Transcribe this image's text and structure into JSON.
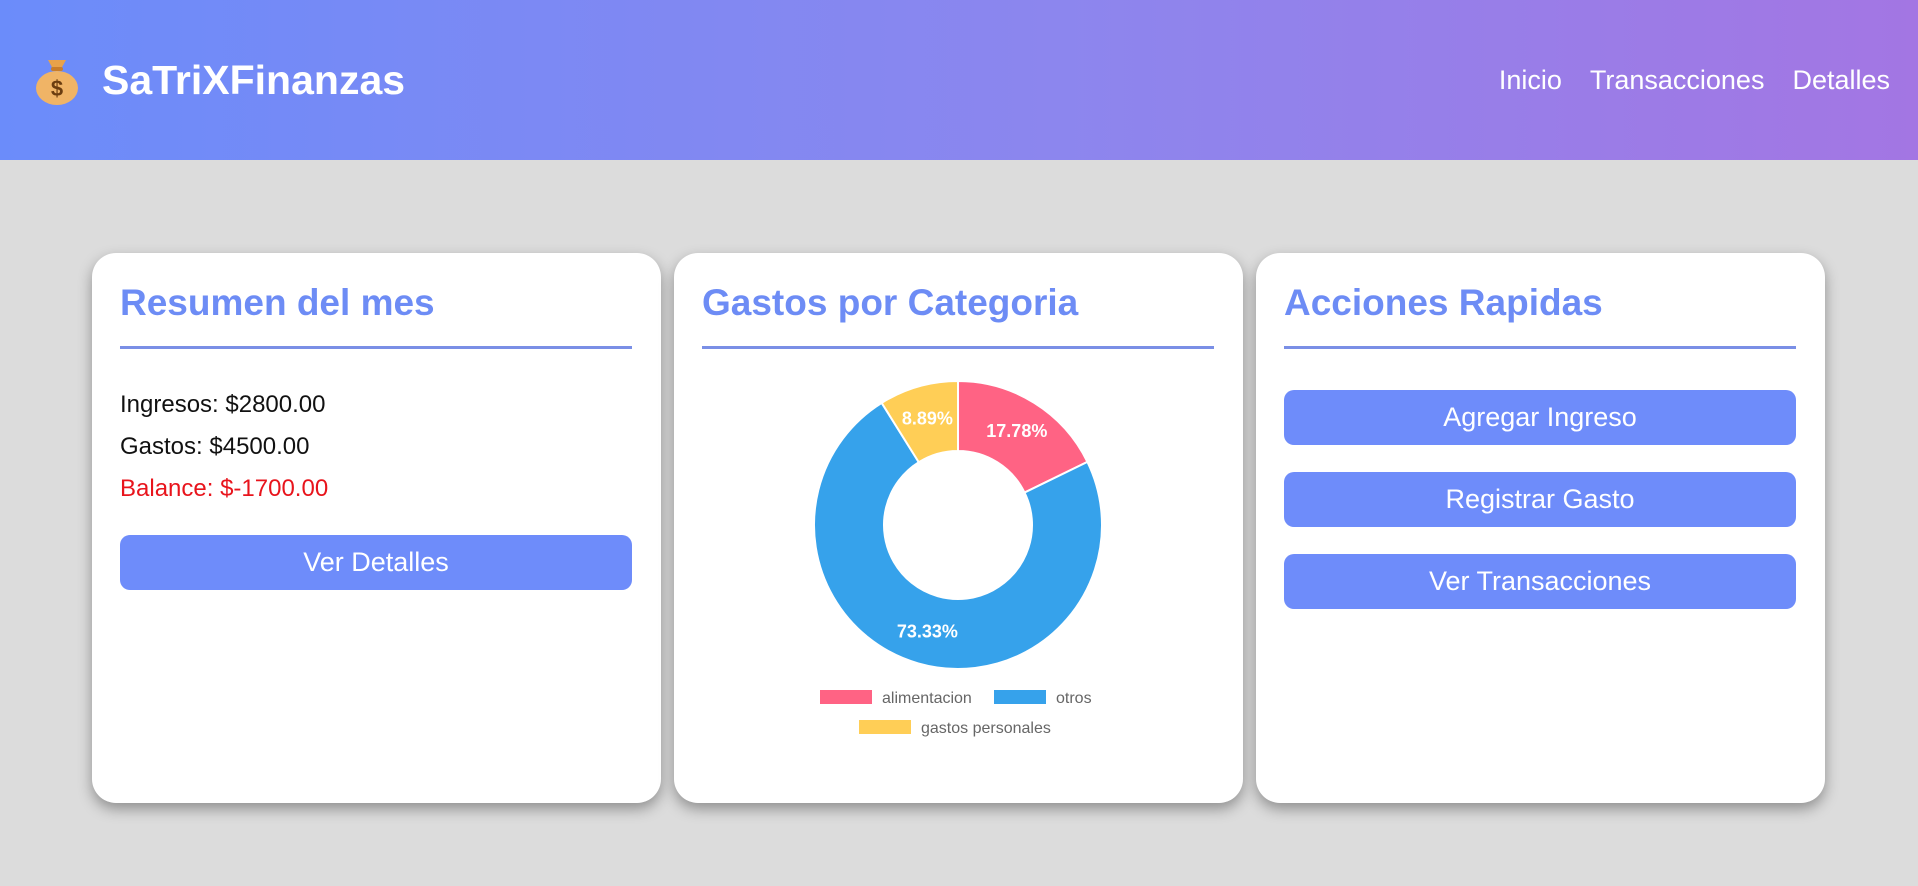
{
  "header": {
    "brand": "SaTriXFinanzas",
    "logo_icon": "money-bag-icon",
    "nav": [
      "Inicio",
      "Transacciones",
      "Detalles"
    ]
  },
  "summary": {
    "title": "Resumen del mes",
    "income_label": "Ingresos: ",
    "income_value": "$2800.00",
    "expenses_label": "Gastos: ",
    "expenses_value": "$4500.00",
    "balance_label": "Balance: ",
    "balance_value": "$-1700.00",
    "balance_color": "#e8141c",
    "button": "Ver Detalles"
  },
  "category_chart": {
    "title": "Gastos por Categoria"
  },
  "chart_data": {
    "type": "pie",
    "variant": "doughnut",
    "labels": [
      "alimentacion",
      "otros",
      "gastos personales"
    ],
    "values": [
      17.78,
      73.33,
      8.89
    ],
    "value_labels": [
      "17.78%",
      "73.33%",
      "8.89%"
    ],
    "colors": [
      "#ff6384",
      "#36a2eb",
      "#ffce56"
    ],
    "legend_position": "bottom"
  },
  "quick_actions": {
    "title": "Acciones Rapidas",
    "buttons": [
      "Agregar Ingreso",
      "Registrar Gasto",
      "Ver Transacciones"
    ]
  },
  "colors": {
    "accent": "#6e8cfa",
    "title": "#6d8cf5",
    "background": "#dcdcdc",
    "header_gradient_start": "#6b8cfa",
    "header_gradient_end": "#a376e3"
  }
}
